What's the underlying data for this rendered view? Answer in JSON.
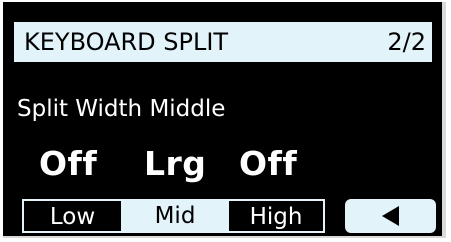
{
  "header": {
    "title": "KEYBOARD SPLIT",
    "page": "2/2"
  },
  "subtitle": "Split Width Middle",
  "values": [
    "Off",
    "Lrg",
    "Off"
  ],
  "segments": [
    {
      "label": "Low",
      "selected": false
    },
    {
      "label": "Mid",
      "selected": true
    },
    {
      "label": "High",
      "selected": false
    }
  ],
  "back_button": {
    "icon": "left-triangle-icon"
  },
  "colors": {
    "screen_bg": "#000000",
    "highlight": "#e2f3fa",
    "text": "#ffffff"
  }
}
